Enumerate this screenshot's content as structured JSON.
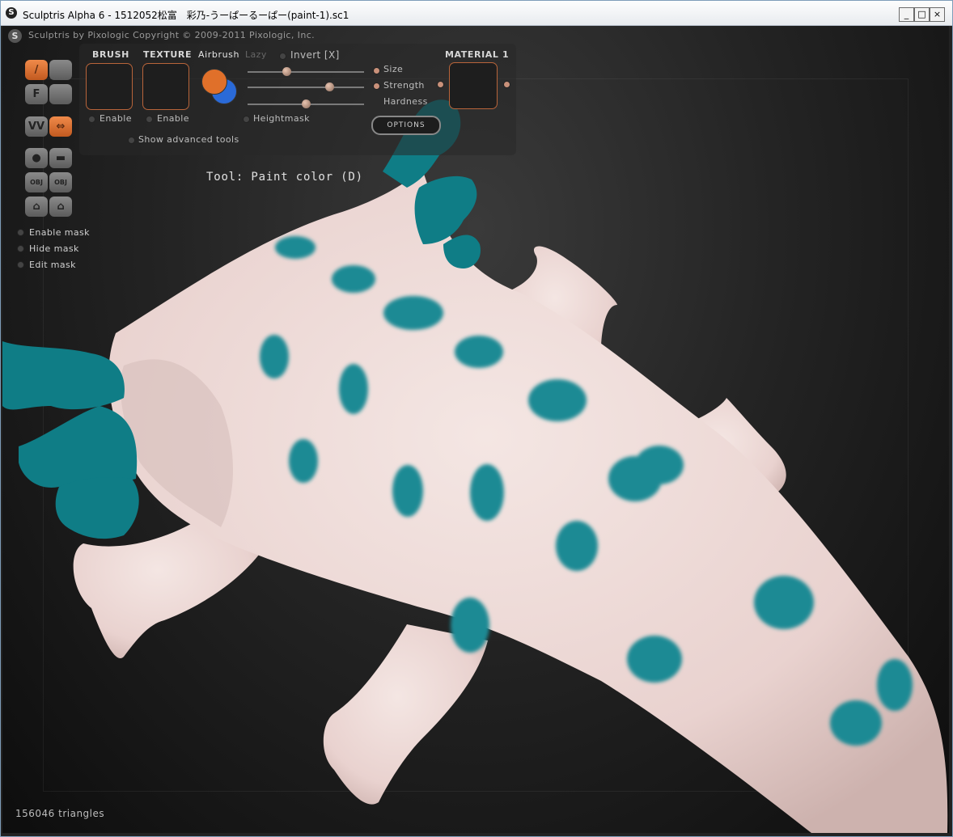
{
  "window": {
    "title": "Sculptris Alpha 6 - 1512052松富　彩乃-うーぱーるーぱー(paint-1).sc1",
    "logo_icon": "sculptris-logo-icon",
    "minimize": "_",
    "maximize": "□",
    "close": "×"
  },
  "app": {
    "copyright": "Sculptris by Pixologic    Copyright © 2009-2011 Pixologic, Inc."
  },
  "panel": {
    "brush_label": "BRUSH",
    "texture_label": "TEXTURE",
    "airbrush_label": "Airbrush",
    "lazy_label": "Lazy",
    "invert_label": "Invert [X]",
    "size_label": "Size",
    "strength_label": "Strength",
    "hardness_label": "Hardness",
    "material_label": "MATERIAL 1",
    "brush_enable": "Enable",
    "texture_enable": "Enable",
    "heightmask": "Heightmask",
    "options_button": "OPTIONS",
    "advanced_tools": "Show advanced tools",
    "primary_color": "#e0702a",
    "secondary_color": "#2a6ad8",
    "size_value": 0.33,
    "strength_value": 0.7,
    "hardness_value": 0.5
  },
  "tool_status": "Tool: Paint color (D)",
  "mask": {
    "enable": "Enable mask",
    "hide": "Hide mask",
    "edit": "Edit mask"
  },
  "tools": [
    {
      "icon": "paint-brush-icon",
      "glyph": "/",
      "active": true
    },
    {
      "icon": "bump-icon",
      "glyph": "",
      "active": false
    },
    {
      "icon": "flatten-icon",
      "glyph": "F",
      "active": false
    },
    {
      "icon": "sculpt-layer-icon",
      "glyph": "",
      "active": false
    },
    {
      "icon": "symmetry-icon",
      "glyph": "VV",
      "active": false
    },
    {
      "icon": "mirror-arrows-icon",
      "glyph": "⇔",
      "active": true
    },
    {
      "icon": "sphere-icon",
      "glyph": "●",
      "active": false
    },
    {
      "icon": "plane-icon",
      "glyph": "▬",
      "active": false
    },
    {
      "icon": "import-obj-icon",
      "glyph": "OBJ",
      "active": false
    },
    {
      "icon": "export-obj-icon",
      "glyph": "OBJ",
      "active": false
    },
    {
      "icon": "save-icon",
      "glyph": "⌂",
      "active": false
    },
    {
      "icon": "load-icon",
      "glyph": "⌂",
      "active": false
    }
  ],
  "status": {
    "triangles": "156046 triangles"
  },
  "model": {
    "skin_color": "#efd9d6",
    "spot_color": "#1d8a94",
    "gill_color": "#0f7d86"
  }
}
